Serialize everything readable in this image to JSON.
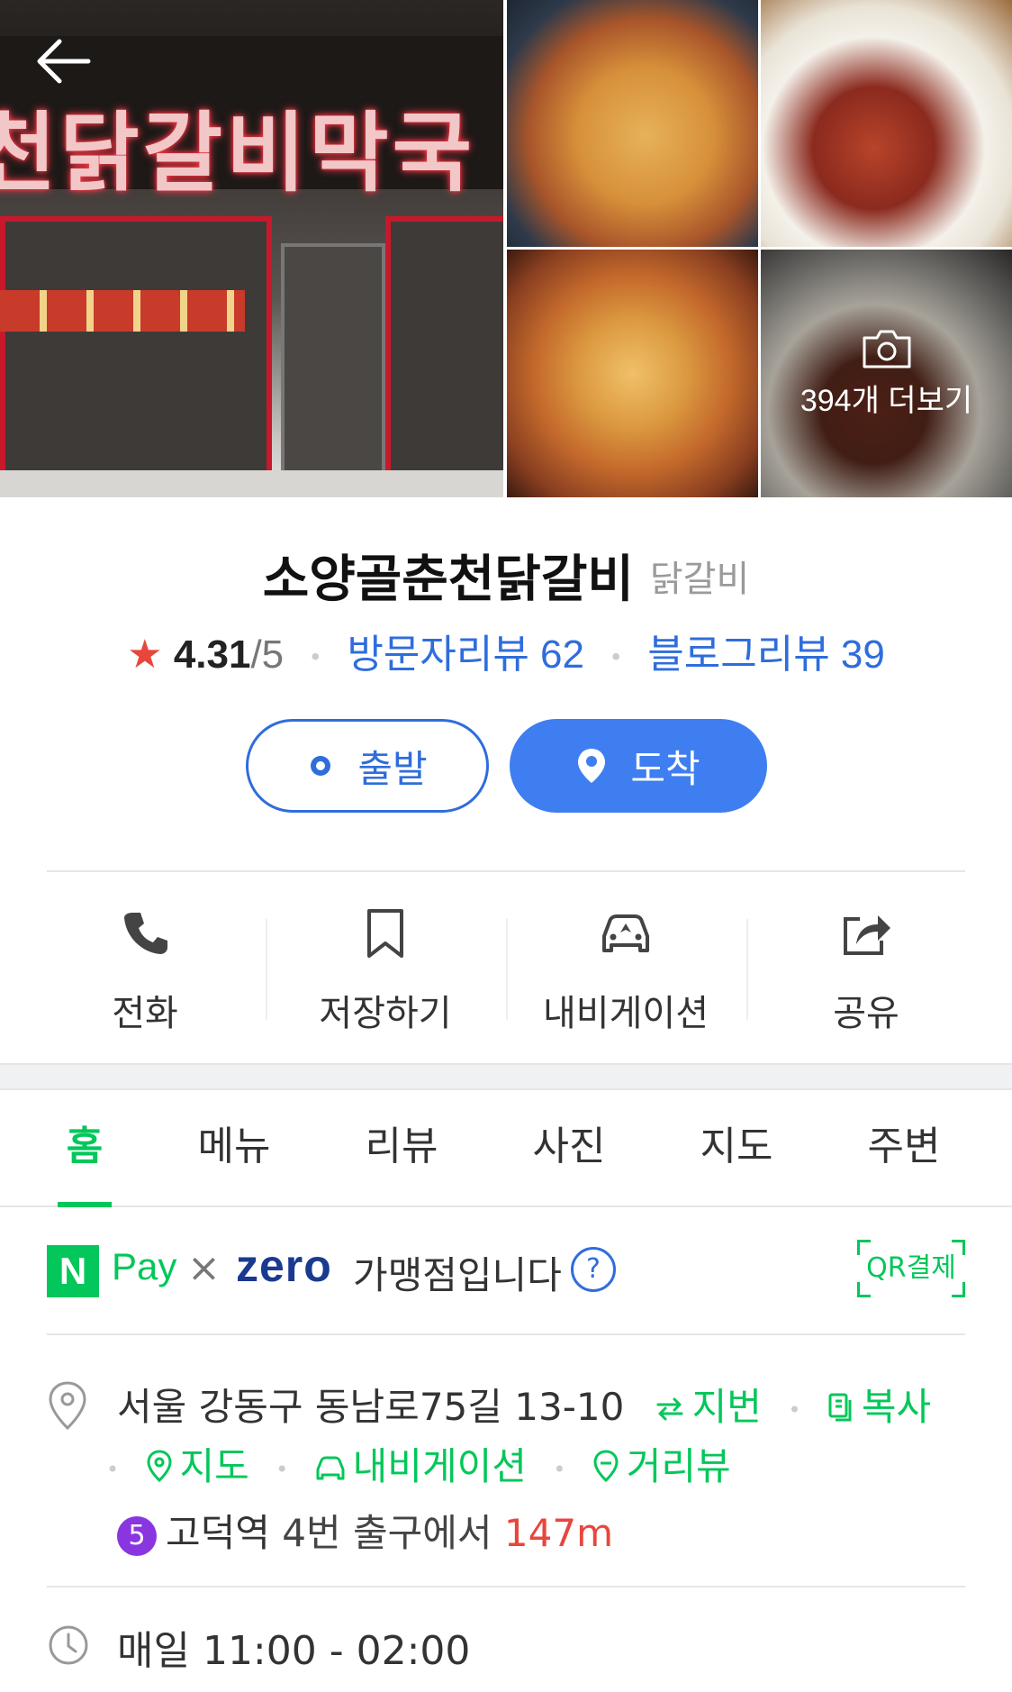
{
  "gallery": {
    "sign_text": "천닭갈비막국",
    "more_photos_label": "394개 더보기"
  },
  "place": {
    "name": "소양골춘천닭갈비",
    "category": "닭갈비",
    "rating": "4.31",
    "rating_out_of": "/5",
    "visitor_reviews": "방문자리뷰 62",
    "blog_reviews": "블로그리뷰 39"
  },
  "route": {
    "depart_label": "출발",
    "arrive_label": "도착"
  },
  "actions": [
    {
      "label": "전화",
      "icon": "phone-icon"
    },
    {
      "label": "저장하기",
      "icon": "bookmark-icon"
    },
    {
      "label": "내비게이션",
      "icon": "car-icon"
    },
    {
      "label": "공유",
      "icon": "share-icon"
    }
  ],
  "tabs": [
    "홈",
    "메뉴",
    "리뷰",
    "사진",
    "지도",
    "주변"
  ],
  "active_tab": "홈",
  "pay": {
    "n_logo": "N",
    "npay_label": "Pay",
    "times": "×",
    "zero_label": "zero",
    "text": "가맹점입니다",
    "help": "?",
    "qr_label": "QR결제"
  },
  "address": {
    "text": "서울 강동구 동남로75길 13-10",
    "lot_label": "지번",
    "copy_label": "복사",
    "map_label": "지도",
    "navi_label": "내비게이션",
    "street_label": "거리뷰"
  },
  "subway": {
    "line": "5",
    "station": "고덕역",
    "exit_text": "4번 출구에서",
    "distance": "147m"
  },
  "hours": {
    "text": "매일 11:00 - 02:00"
  },
  "colors": {
    "brand_green": "#03c75a",
    "link_blue": "#2f6ddc",
    "arrive_blue": "#3f7ef0",
    "star_red": "#e8463c",
    "subway_line5": "#8936e0"
  }
}
